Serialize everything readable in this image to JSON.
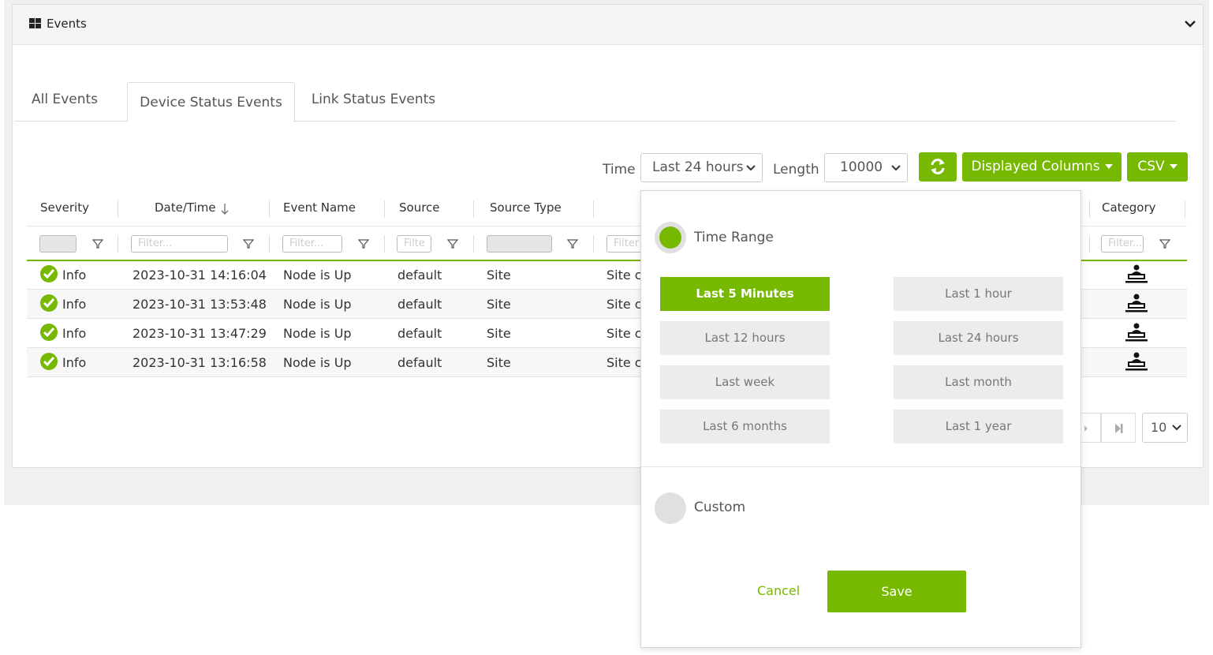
{
  "panel": {
    "title": "Events"
  },
  "tabs": [
    {
      "label": "All Events"
    },
    {
      "label": "Device Status Events"
    },
    {
      "label": "Link Status Events"
    }
  ],
  "toolbar": {
    "time_label": "Time",
    "time_value": "Last 24 hours",
    "length_label": "Length",
    "length_value": "10000",
    "displayed_columns_label": "Displayed Columns",
    "csv_label": "CSV"
  },
  "table": {
    "columns": [
      {
        "label": "Severity"
      },
      {
        "label": "Date/Time"
      },
      {
        "label": "Event Name"
      },
      {
        "label": "Source"
      },
      {
        "label": "Source Type"
      },
      {
        "label": "Category"
      }
    ],
    "filter_placeholders": {
      "datetime": "Filter...",
      "event_name": "Filter...",
      "source": "Filte",
      "description": "Filter",
      "category": "Filter..."
    },
    "rows": [
      {
        "severity": "Info",
        "datetime": "2023-10-31 14:16:04",
        "event_name": "Node is Up",
        "source": "default",
        "source_type": "Site",
        "desc": "Site c"
      },
      {
        "severity": "Info",
        "datetime": "2023-10-31 13:53:48",
        "event_name": "Node is Up",
        "source": "default",
        "source_type": "Site",
        "desc": "Site c"
      },
      {
        "severity": "Info",
        "datetime": "2023-10-31 13:47:29",
        "event_name": "Node is Up",
        "source": "default",
        "source_type": "Site",
        "desc": "Site c"
      },
      {
        "severity": "Info",
        "datetime": "2023-10-31 13:16:58",
        "event_name": "Node is Up",
        "source": "default",
        "source_type": "Site",
        "desc": "Site c"
      }
    ]
  },
  "pager": {
    "page_size": "10"
  },
  "time_dropdown": {
    "time_range_label": "Time Range",
    "custom_label": "Custom",
    "options": [
      {
        "label": "Last 5 Minutes",
        "active": true
      },
      {
        "label": "Last 1 hour"
      },
      {
        "label": "Last 12 hours"
      },
      {
        "label": "Last 24 hours"
      },
      {
        "label": "Last week"
      },
      {
        "label": "Last month"
      },
      {
        "label": "Last 6 months"
      },
      {
        "label": "Last 1 year"
      }
    ],
    "cancel_label": "Cancel",
    "save_label": "Save"
  },
  "colors": {
    "accent": "#76b900",
    "severity_info": "#76b900"
  },
  "icons": {
    "panel": "grid-icon",
    "collapse": "chevron-down-icon",
    "refresh": "refresh-icon",
    "severity": "check-circle-icon",
    "category": "device-user-icon",
    "filter": "funnel-icon",
    "sort": "arrow-down-icon"
  }
}
